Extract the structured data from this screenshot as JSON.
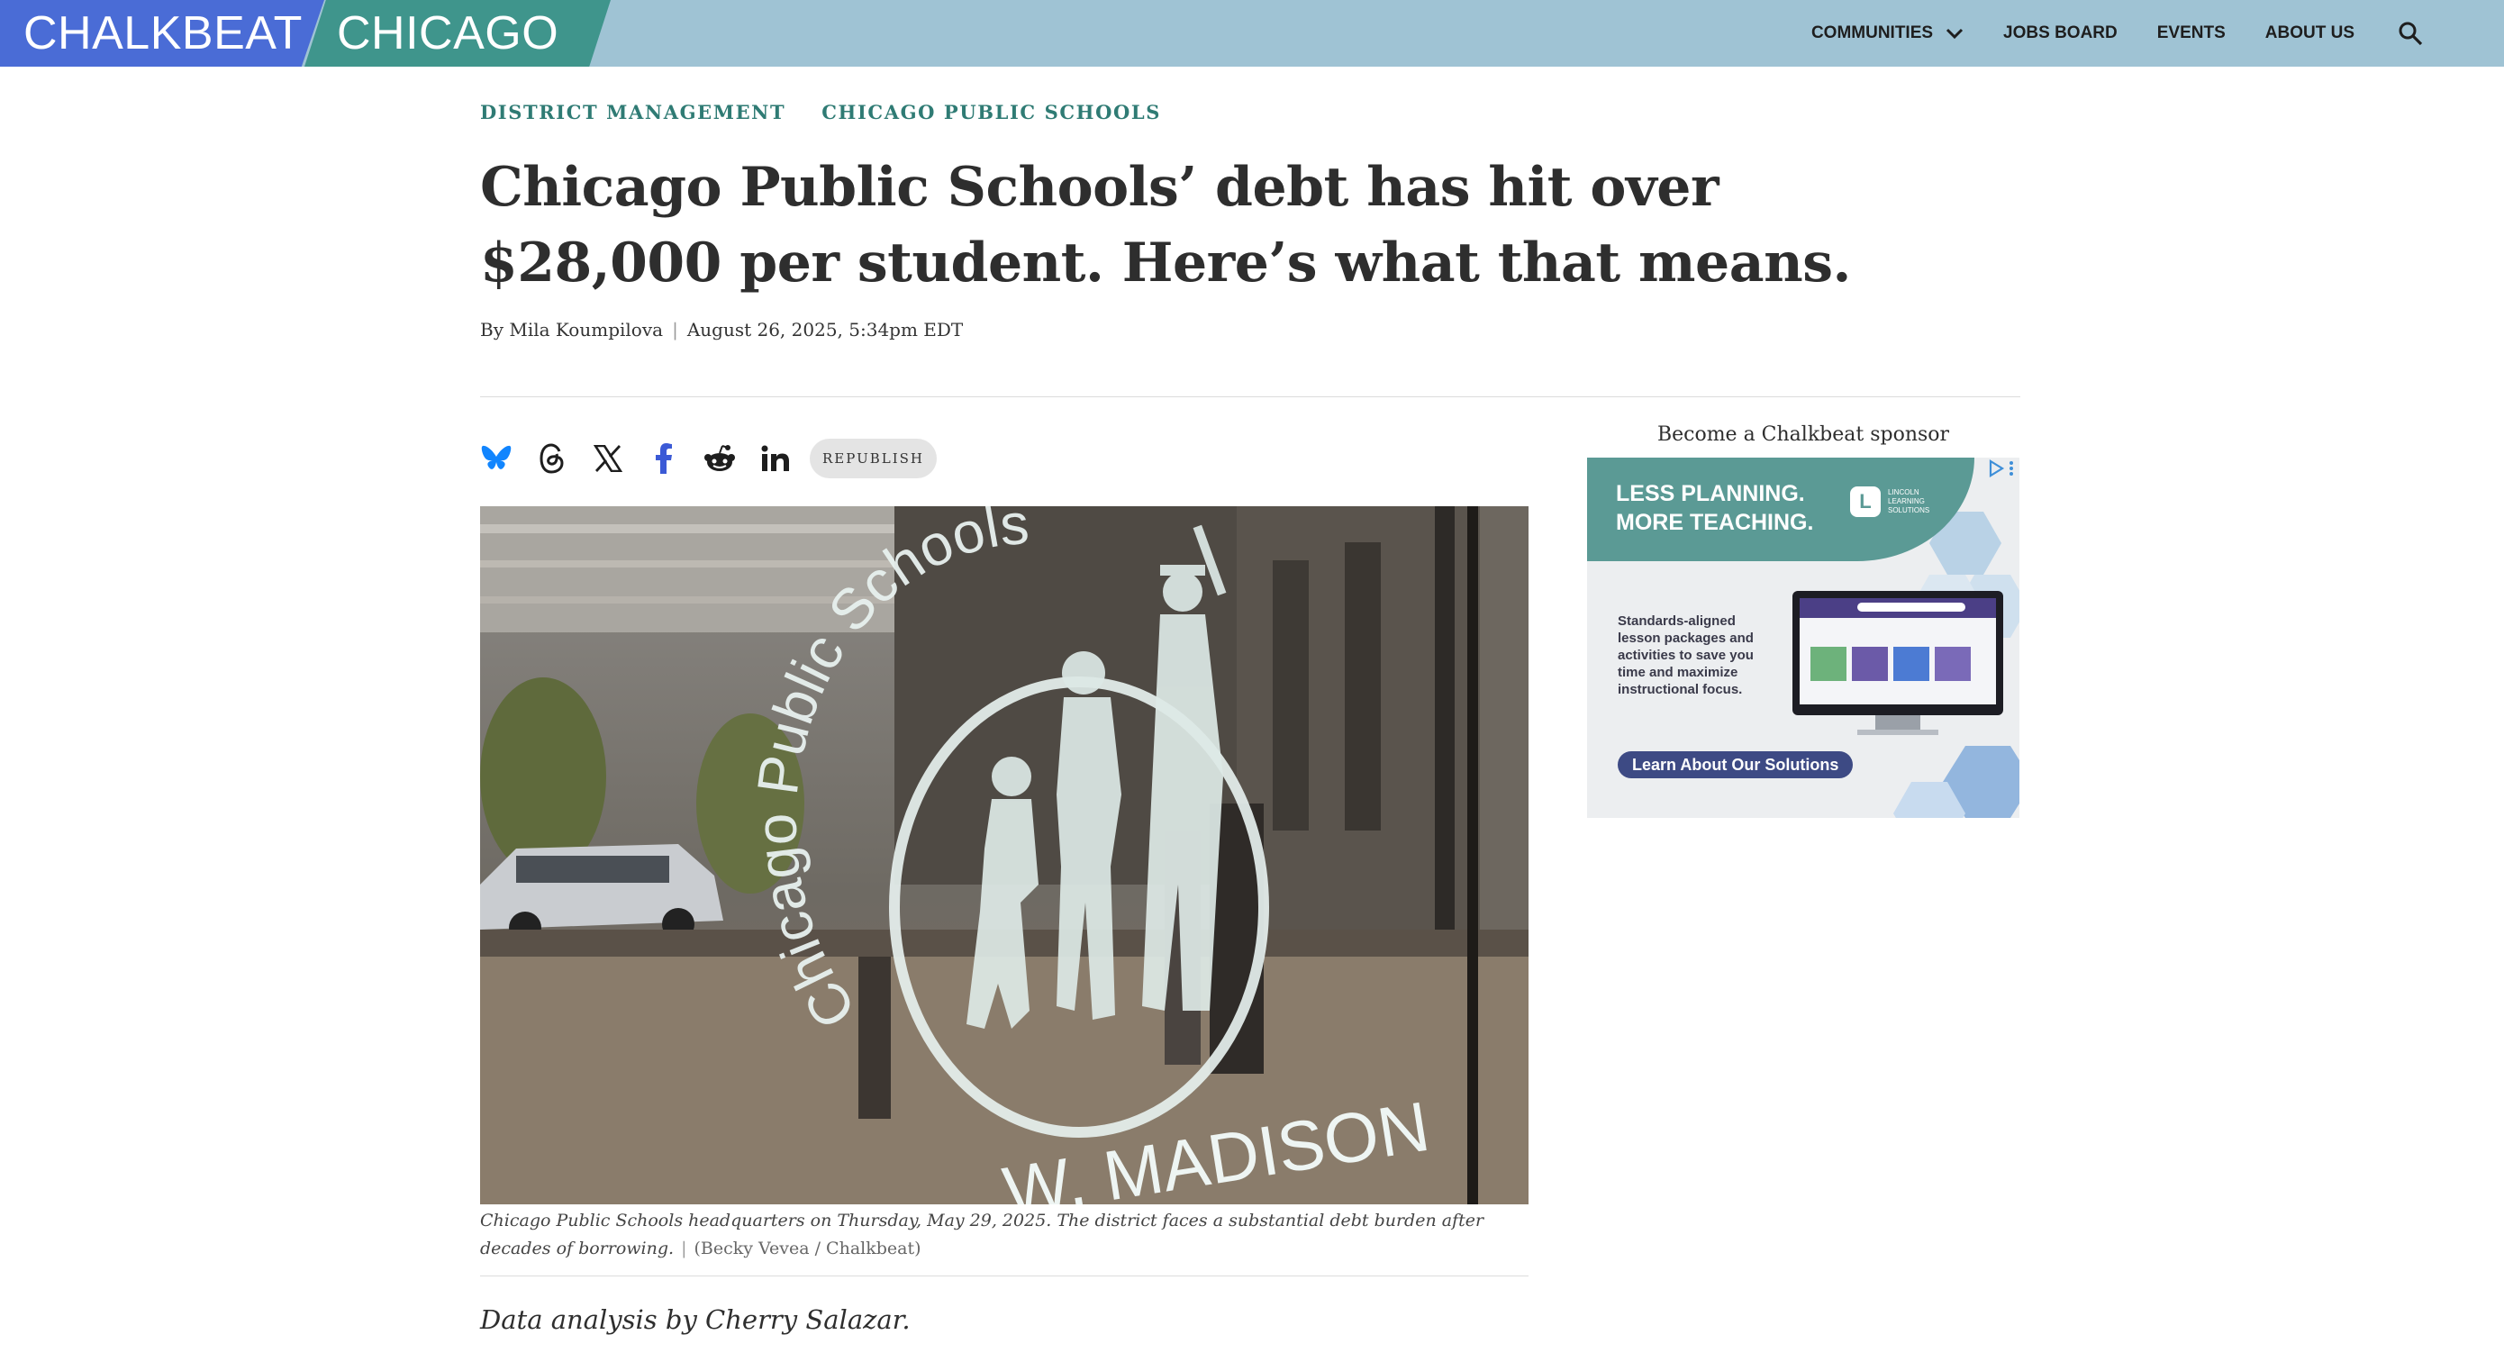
{
  "header": {
    "logo_left": "CHALKBEAT",
    "logo_right": "CHICAGO",
    "nav": [
      {
        "label": "COMMUNITIES",
        "icon": "chevron-down-icon"
      },
      {
        "label": "JOBS BOARD"
      },
      {
        "label": "EVENTS"
      },
      {
        "label": "ABOUT US"
      }
    ],
    "search_icon": "search-icon"
  },
  "article": {
    "categories": [
      "DISTRICT MANAGEMENT",
      "CHICAGO PUBLIC SCHOOLS"
    ],
    "headline": "Chicago Public Schools’ debt has hit over $28,000 per student. Here’s what that means.",
    "byline": "By Mila Koumpilova",
    "date": "August 26, 2025, 5:34pm EDT",
    "share_icons": [
      "bluesky-icon",
      "threads-icon",
      "x-icon",
      "facebook-icon",
      "reddit-icon",
      "linkedin-icon"
    ],
    "republish_label": "REPUBLISH",
    "photo": {
      "sign_text_top": "Chicago Public Schools",
      "sign_text_bottom": "W. MADISON",
      "caption": "Chicago Public Schools headquarters on Thursday, May 29, 2025. The district faces a substantial debt burden after decades of borrowing.",
      "credit": "(Becky Vevea / Chalkbeat)"
    },
    "body_first": "Data analysis by Cherry Salazar."
  },
  "sidebar": {
    "sponsor_label": "Become a Chalkbeat sponsor",
    "ad": {
      "headline_1": "LESS PLANNING.",
      "headline_2": "MORE TEACHING.",
      "logo_mark": "L",
      "logo_text": "LINCOLN LEARNING SOLUTIONS",
      "body": "Standards-aligned lesson packages and activities to save you time and maximize instructional focus.",
      "cta": "Learn About Our Solutions"
    }
  },
  "colors": {
    "topbar": "#9fc3d4",
    "logo_left": "#4a6cd6",
    "logo_right": "#3f958c",
    "category": "#2f7b74",
    "bluesky": "#1185fe",
    "facebook": "#1877f2"
  }
}
